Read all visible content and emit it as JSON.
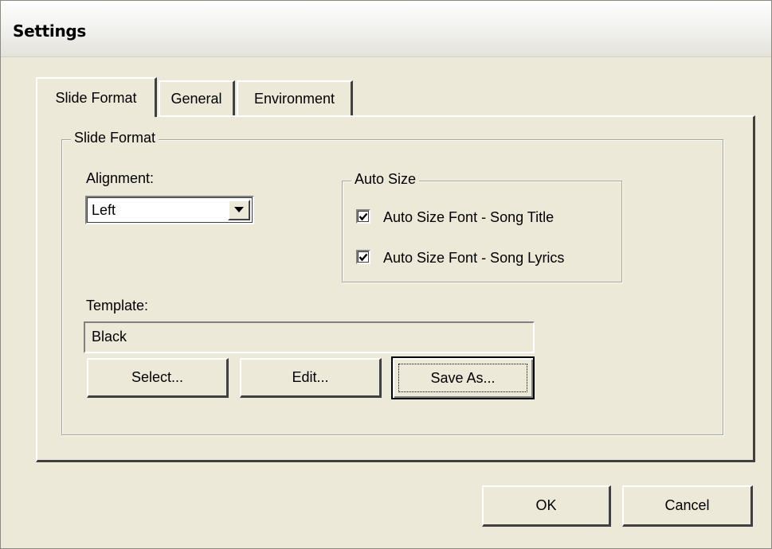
{
  "window": {
    "title": "Settings"
  },
  "tabs": [
    {
      "label": "Slide Format",
      "active": true
    },
    {
      "label": "General",
      "active": false
    },
    {
      "label": "Environment",
      "active": false
    }
  ],
  "slide_format_group": {
    "legend": "Slide Format",
    "alignment": {
      "label": "Alignment:",
      "value": "Left"
    },
    "auto_size": {
      "legend": "Auto Size",
      "options": [
        {
          "label": "Auto Size Font - Song Title",
          "checked": true
        },
        {
          "label": "Auto Size Font - Song Lyrics",
          "checked": true
        }
      ]
    },
    "template": {
      "label": "Template:",
      "value": "Black",
      "select_label": "Select...",
      "edit_label": "Edit...",
      "save_as_label": "Save As..."
    }
  },
  "footer": {
    "ok_label": "OK",
    "cancel_label": "Cancel"
  },
  "icons": {
    "dropdown": "chevron-down-icon",
    "check": "check-icon"
  }
}
